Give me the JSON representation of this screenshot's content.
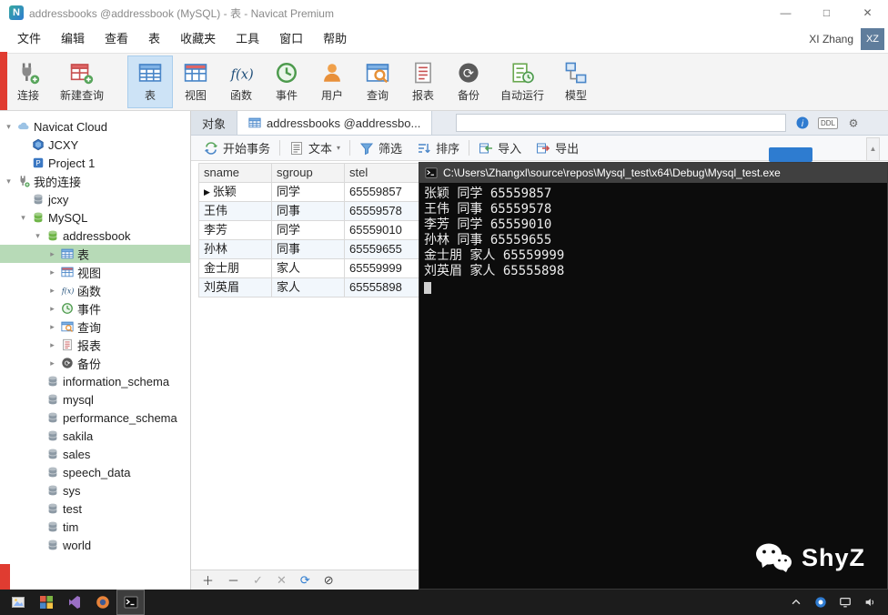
{
  "titlebar": {
    "title": "addressbooks @addressbook (MySQL) - 表 - Navicat Premium",
    "logo": "N",
    "minimize_glyph": "—",
    "maximize_glyph": "□",
    "close_glyph": "✕"
  },
  "menubar": {
    "items": [
      "文件",
      "编辑",
      "查看",
      "表",
      "收藏夹",
      "工具",
      "窗口",
      "帮助"
    ],
    "user_name": "XI Zhang",
    "user_badge": "XZ"
  },
  "toolbar": [
    {
      "label": "连接"
    },
    {
      "label": "新建查询"
    },
    {
      "label": "表"
    },
    {
      "label": "视图"
    },
    {
      "label": "函数"
    },
    {
      "label": "事件"
    },
    {
      "label": "用户"
    },
    {
      "label": "查询"
    },
    {
      "label": "报表"
    },
    {
      "label": "备份"
    },
    {
      "label": "自动运行"
    },
    {
      "label": "模型"
    }
  ],
  "sidebar": {
    "items": [
      {
        "label": "Navicat Cloud"
      },
      {
        "label": "JCXY"
      },
      {
        "label": "Project 1"
      },
      {
        "label": "我的连接"
      },
      {
        "label": "jcxy"
      },
      {
        "label": "MySQL"
      },
      {
        "label": "addressbook"
      },
      {
        "label": "表"
      },
      {
        "label": "视图"
      },
      {
        "label": "函数"
      },
      {
        "label": "事件"
      },
      {
        "label": "查询"
      },
      {
        "label": "报表"
      },
      {
        "label": "备份"
      },
      {
        "label": "information_schema"
      },
      {
        "label": "mysql"
      },
      {
        "label": "performance_schema"
      },
      {
        "label": "sakila"
      },
      {
        "label": "sales"
      },
      {
        "label": "speech_data"
      },
      {
        "label": "sys"
      },
      {
        "label": "test"
      },
      {
        "label": "tim"
      },
      {
        "label": "world"
      }
    ]
  },
  "tabs": {
    "objects": "对象",
    "table_tab": "addressbooks @addressbo..."
  },
  "object_toolbar": {
    "transaction": "开始事务",
    "text": "文本",
    "filter": "筛选",
    "sort": "排序",
    "import": "导入",
    "export": "导出"
  },
  "right_icons": {
    "ddl": "DDL"
  },
  "grid": {
    "columns": [
      "sname",
      "sgroup",
      "stel"
    ],
    "rows": [
      [
        "张颖",
        "同学",
        "65559857"
      ],
      [
        "王伟",
        "同事",
        "65559578"
      ],
      [
        "李芳",
        "同学",
        "65559010"
      ],
      [
        "孙林",
        "同事",
        "65559655"
      ],
      [
        "金士朋",
        "家人",
        "65559999"
      ],
      [
        "刘英眉",
        "家人",
        "65555898"
      ]
    ]
  },
  "grid_footer": {
    "add": "＋",
    "remove": "－",
    "apply": "✓",
    "discard": "✕",
    "refresh": "⟳",
    "stop": "⊘"
  },
  "console": {
    "title": "C:\\Users\\Zhangxl\\source\\repos\\Mysql_test\\x64\\Debug\\Mysql_test.exe",
    "lines": [
      "张颖 同学 65559857",
      "王伟 同事 65559578",
      "李芳 同学 65559010",
      "孙林 同事 65559655",
      "金士朋 家人 65559999",
      "刘英眉 家人 65555898"
    ],
    "watermark": "ShyZ"
  }
}
